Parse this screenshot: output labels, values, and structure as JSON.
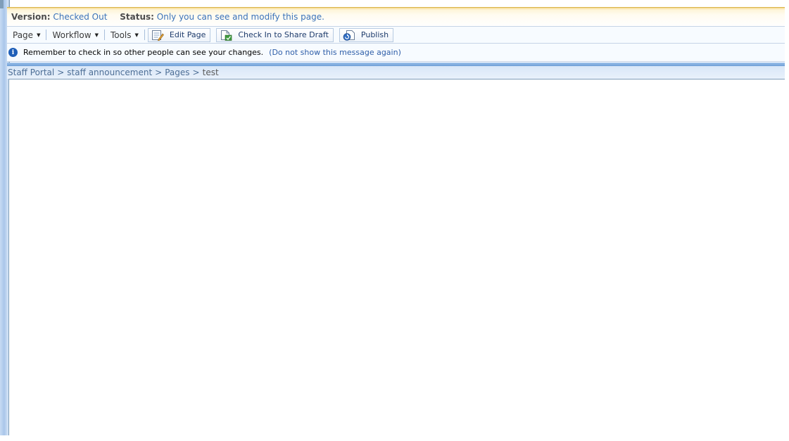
{
  "console": {
    "version_label": "Version:",
    "version_value": "Checked Out",
    "status_label": "Status:",
    "status_value": "Only you can see and modify this page."
  },
  "toolbar": {
    "menus": [
      {
        "label": "Page"
      },
      {
        "label": "Workflow"
      },
      {
        "label": "Tools"
      }
    ],
    "buttons": {
      "edit_page": {
        "label": "Edit Page",
        "icon": "edit-page-icon"
      },
      "check_in": {
        "label": "Check In to Share Draft",
        "icon": "check-in-icon"
      },
      "publish": {
        "label": "Publish",
        "icon": "publish-icon"
      }
    }
  },
  "info": {
    "icon": "info-icon",
    "message": "Remember to check in so other people can see your changes.",
    "dismiss_link": "(Do not show this message again)"
  },
  "breadcrumb": {
    "items": [
      "Staff Portal",
      "staff announcement",
      "Pages"
    ],
    "separator": ">",
    "current": "test"
  },
  "colors": {
    "accent_blue": "#3b73b9",
    "status_bar_top": "#f7d98e",
    "info_icon": "#1f5fb8"
  }
}
